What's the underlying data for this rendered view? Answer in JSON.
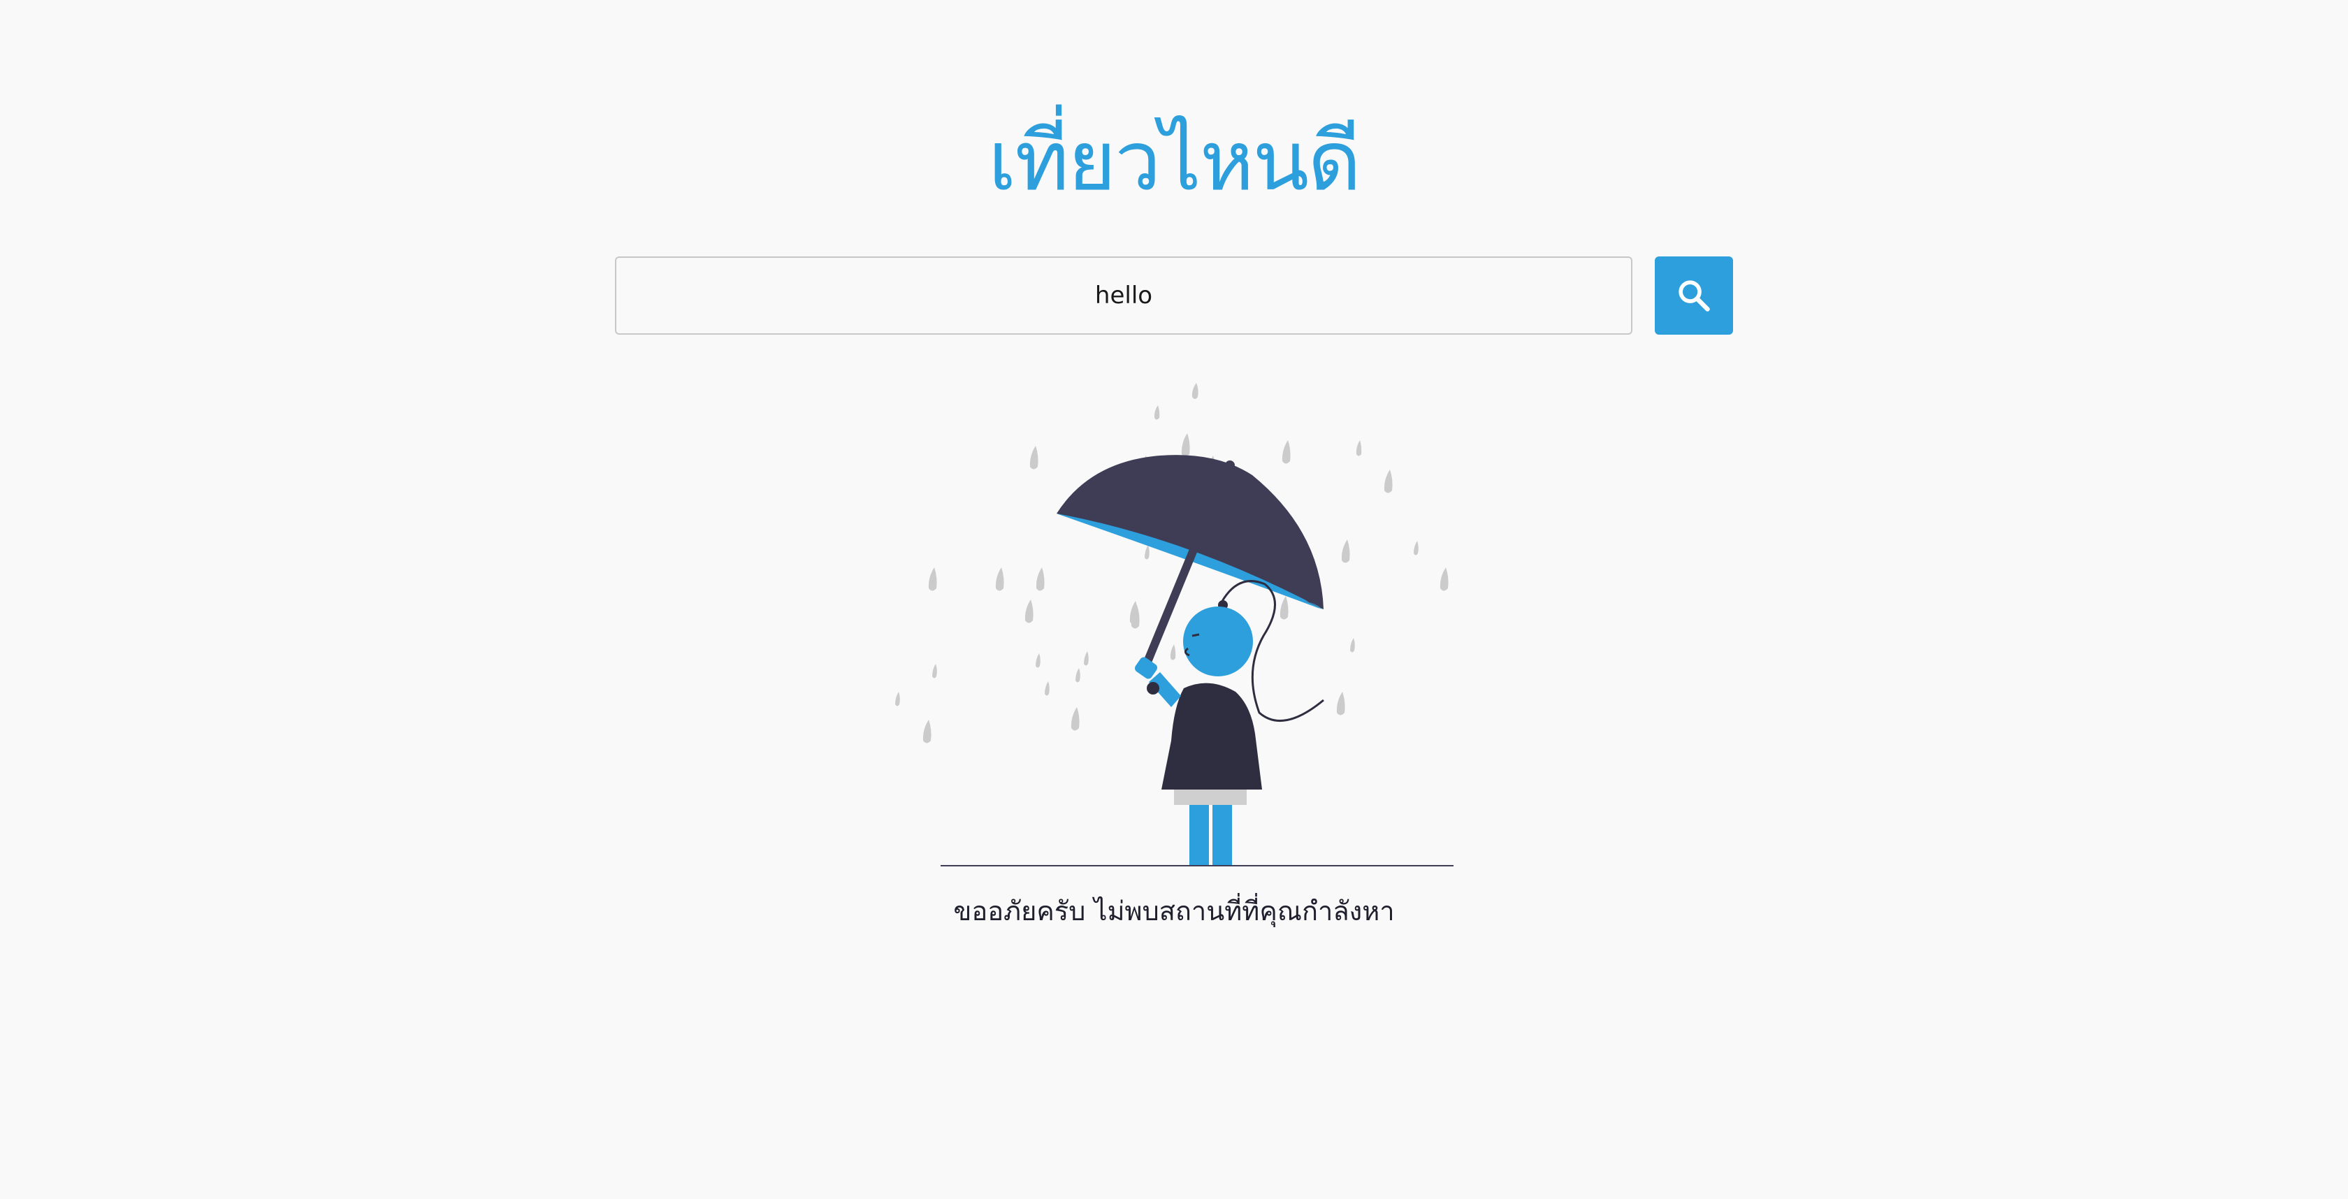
{
  "header": {
    "logo_text": "เที่ยวไหนดี"
  },
  "search": {
    "value": "hello",
    "button_icon": "search-icon"
  },
  "empty_state": {
    "illustration": "person-with-umbrella-in-rain",
    "message": "ขออภัยครับ ไม่พบสถานที่ที่คุณกำลังหา"
  },
  "colors": {
    "accent": "#2d9fdc",
    "background": "#f9f9f9",
    "umbrella": "#3f3d56",
    "dress": "#2f2e41",
    "raindrop": "#cbcbcb"
  }
}
